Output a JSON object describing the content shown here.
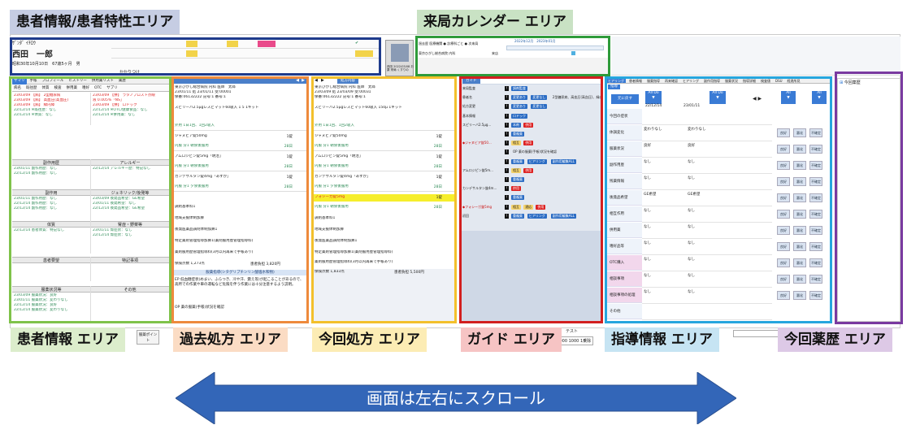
{
  "labels": {
    "patient_attr": "患者情報/患者特性エリア",
    "calendar": "来局カレンダー エリア",
    "patient": "患者情報 エリア",
    "past_rx": "過去処方 エリア",
    "current_rx": "今回処方 エリア",
    "guide": "ガイド エリア",
    "guidance": "指導情報 エリア",
    "history": "今回薬歴 エリア"
  },
  "scroll_hint": "画面は左右にスクロール",
  "colors": {
    "patient_attr": "#1f3b8c",
    "calendar": "#2e9b3a",
    "patient": "#7fc34a",
    "past_rx": "#ee8a3c",
    "current_rx": "#f3c02c",
    "guide": "#d21f1f",
    "guidance": "#26a6de",
    "history": "#7a3aa0",
    "arrow": "#3366b8"
  },
  "header": {
    "kana": "ｻﾞﾝﾀﾞ ｲﾁﾛｳ",
    "name": "西田　一郎",
    "birth": "昭和30年10月10日　67歳5ヶ月　男",
    "fields": [
      "相互連絡",
      "妊娠授乳",
      "喫煙",
      "副作用歴",
      "アレルギー",
      "疾病",
      "OTC",
      "後発品",
      "運転",
      "粉砕"
    ],
    "visit_label": "かかりつけ",
    "photo_caption": "西田 2022/03/08 お薬 来局 くすりの"
  },
  "calendar": {
    "top_row": "過去歴 医療機関 ● 診療科ごと ● 次来局",
    "months": "2022年12月　2023年01月",
    "hospital": "東京ひがし総合病院 内科",
    "status": "来店"
  },
  "patient_area": {
    "tabs": [
      "サマリ",
      "手帳",
      "プロフィール",
      "ヒストリー",
      "併用薬リスト",
      "薬歴"
    ],
    "sub_tabs": [
      "病名",
      "既往歴",
      "体質",
      "検査",
      "併用薬",
      "嗜好",
      "OTC",
      "サプリ"
    ],
    "left_rows": [
      "23/03/09 【病】 2型糖尿病",
      "23/03/09 【病】 高血圧(高血圧)",
      "23/03/09 【病】 緑内障",
      "22/12/14 ※既往歴：なし",
      "22/12/14 ※体質：なし"
    ],
    "right_rows": [
      "23/03/09 【併】 ラタノプロスト点眼",
      "液 0.005%「NS」",
      "23/03/09 【併】 ロドック",
      "22/12/14 ※OTC/健康食品：なし",
      "22/12/14 ※併用薬：なし"
    ],
    "h_side": "副作用歴",
    "h_allergy": "アレルギー",
    "side_rows": [
      "23/01/11 副作用歴：なし",
      "22/12/14 副作用歴：なし"
    ],
    "allergy_rows": [
      "22/12/14 アレルギー歴：特記なし"
    ],
    "h_side2": "副作用",
    "h_generic": "ジェネリック/後発等",
    "side2_rows": [
      "23/01/11 副作用歴：なし",
      "22/12/14 副作用歴：なし",
      "22/12/14 副作用歴：なし"
    ],
    "generic_rows": [
      "23/03/09 後発品希望：GE希望",
      "23/01/11 後発希望：なし",
      "22/12/14 後発品希望：GE希望"
    ],
    "h_body": "体質",
    "h_renal": "腎症・野菜等",
    "body_rows": [
      "22/12/14 患者体質：特記なし"
    ],
    "renal_rows": [
      "23/01/11 腎症状：なし",
      "22/12/14 腎症状：なし"
    ],
    "h_hope": "患者要望",
    "h_notes": "特記事項",
    "h_tablet": "服薬状況等",
    "h_other": "その他",
    "tablet_rows": [
      "23/03/09 服薬状況：良好",
      "23/01/11 服薬状況：変わりなし",
      "22/12/14 服薬状況：良好",
      "22/12/14 服薬状況：変わりなし"
    ]
  },
  "past_rx": {
    "hospital": "東京ひがし総合病院 内科 医師　太郎",
    "dates": "23/01/11 処 23/01/11 受:00001",
    "insurance": "保番:06132222 記号:1 番号:1",
    "drugs": [
      {
        "name": "スピリーバ2.5μgレスピマット60吸入 1 5 1キット",
        "usage": "外用 1日1回、1回2吸入",
        "qty": "1"
      },
      {
        "name": "ジャヌビア錠50mg",
        "usage": "内服 分1 朝食後服用",
        "qty": "28日",
        "dose": "1錠"
      },
      {
        "name": "アムロジピン錠5mg「明治」",
        "usage": "内服 分1 朝食後服用",
        "qty": "28日",
        "dose": "1錠"
      },
      {
        "name": "カンデサルタン錠4mg「あすか」",
        "usage": "内服 分1 夕食後服用",
        "qty": "28日",
        "dose": "1錠"
      }
    ],
    "fees": [
      "調剤基本料1",
      "地域支援体制加算",
      "後発医薬品調剤体制加算1",
      "特定薬剤管理指導加算1(薬剤服用歴管理指導料)",
      "薬剤服用歴管理指導料(3月以内再来で手帳あり)"
    ],
    "total": "保険点数 1,273点",
    "burden": "患者負担 3,820円",
    "section": "服薬指導(シタグリプチンリン酸塩水和物)",
    "ep": "EP 低血糖症状(めまい、ふらつき、冷や汗、震え等)が起こることがあるので、高所での作業や車の運転など危険を伴う作業には十分注意するよう説明。",
    "op": "OP 薬の服薬(手帳)状況を確認"
  },
  "current_rx": {
    "tab": "処方内容",
    "hospital": "東京ひがし総合病院 内科 医師　太郎",
    "dates": "23/03/09 処 23/03/09 受:00031",
    "insurance": "保番:06132222 記号:1 番号:1",
    "drugs": [
      {
        "name": "スピリーバ2.5μgレスピマット60吸入 150μ 1キット",
        "usage": "外用 1日1回、1回2吸入",
        "qty": "1"
      },
      {
        "name": "ジャヌビア錠50mg",
        "usage": "内服 分1 朝食後服用",
        "qty": "28日",
        "dose": "1錠"
      },
      {
        "name": "アムロジピン錠5mg「明治」",
        "usage": "内服 分1 朝食後服用",
        "qty": "28日",
        "dose": "1錠"
      },
      {
        "name": "カンデサルタン錠4mg「あすか」",
        "usage": "内服 分1 夕食後服用",
        "qty": "28日",
        "dose": "1錠"
      },
      {
        "name": "フォシーガ錠5mg",
        "usage": "内服 分1 朝食後服用",
        "qty": "28日",
        "dose": "1錠"
      }
    ],
    "fees": [
      "調剤基本料1",
      "地域支援体制加算",
      "後発医薬品調剤体制加算1",
      "特定薬剤管理指導加算1(薬剤服用歴管理指導料)",
      "薬剤服用歴管理指導料(3月以内再来で手帳あり)"
    ],
    "total": "保険点数 1,833点",
    "burden": "患者負担 5,500円"
  },
  "guide": {
    "tab": "ガイド",
    "rows": [
      {
        "label": "来局監査",
        "items": [
          "調剤監査"
        ]
      },
      {
        "label": "患者名",
        "items": [
          "変更あり",
          "変更なし",
          "2型糖尿病、高血圧(高血圧)、緑内障"
        ]
      },
      {
        "label": "処方変更",
        "items": [
          "変更あり",
          "変更なし"
        ]
      },
      {
        "label": "基本情報",
        "items": [
          "ロドック"
        ]
      },
      {
        "label": "スピリーバ2.5μg...",
        "items": [
          "本剤",
          "併用"
        ]
      },
      {
        "label": "",
        "items": [
          "重複薬"
        ]
      },
      {
        "label": "◆ジャヌビア錠50...",
        "items": [
          "相互",
          "併用"
        ]
      },
      {
        "label": "",
        "items": [
          "OP 薬の服薬(手帳)状況を確認"
        ]
      },
      {
        "label": "",
        "items": [
          "重複薬",
          "ヒアリング",
          "副作用編集ALL"
        ]
      },
      {
        "label": "アムロジピン錠5m...",
        "items": [
          "相互",
          "併用"
        ]
      },
      {
        "label": "",
        "items": [
          "重複薬"
        ]
      },
      {
        "label": "カンデサルタン錠4m...",
        "items": [
          "併用"
        ]
      },
      {
        "label": "",
        "items": [
          "重複薬"
        ]
      },
      {
        "label": "◆フォシーガ錠5mg",
        "items": [
          "相互",
          "適応",
          "併用"
        ]
      },
      {
        "label": "初回",
        "items": [
          "重複薬",
          "ヒアリング",
          "副作用編集ALL"
        ]
      }
    ]
  },
  "guidance": {
    "tabs": [
      "ヒアリング",
      "患者情報",
      "服薬指導",
      "再来確認",
      "ヒアリング",
      "副作用指導",
      "服薬状況",
      "指導詳細",
      "検査値",
      "DSU",
      "経過所見"
    ],
    "selected_tab": "指導",
    "back_btn": "元に戻す",
    "col1_date": "22/12/14",
    "col2_date": "23/01/11",
    "do_label": "All Do",
    "all_label": "All",
    "rows": [
      {
        "label": "今回の症状",
        "v1": "",
        "v2": ""
      },
      {
        "label": "体調変化",
        "v1": "変わりなし",
        "v2": "変わりなし"
      },
      {
        "label": "服薬状況",
        "v1": "良好",
        "v2": "良好"
      },
      {
        "label": "副作用歴",
        "v1": "なし",
        "v2": "なし"
      },
      {
        "label": "残薬情報",
        "v1": "なし",
        "v2": "なし"
      },
      {
        "label": "後発品希望",
        "v1": "GE希望",
        "v2": "GE希望"
      },
      {
        "label": "相互作用",
        "v1": "なし",
        "v2": "なし"
      },
      {
        "label": "併用薬",
        "v1": "なし",
        "v2": "なし"
      },
      {
        "label": "嗜好品等",
        "v1": "なし",
        "v2": "なし"
      },
      {
        "label": "OTC購入",
        "v1": "なし",
        "v2": "なし"
      },
      {
        "label": "相談事項",
        "v1": "なし",
        "v2": "なし"
      },
      {
        "label": "相談事項の処理",
        "v1": "なし",
        "v2": "なし"
      },
      {
        "label": "その他",
        "v1": "",
        "v2": ""
      }
    ],
    "btn_a": "良好",
    "btn_b": "悪化",
    "btn_c": "不確定"
  },
  "history_area": {
    "title": "今回薬歴"
  },
  "bottom_bar": {
    "left_btn": "服薬ポイント",
    "text_mid": "テスト",
    "code": "C000 1000 1乗除"
  }
}
